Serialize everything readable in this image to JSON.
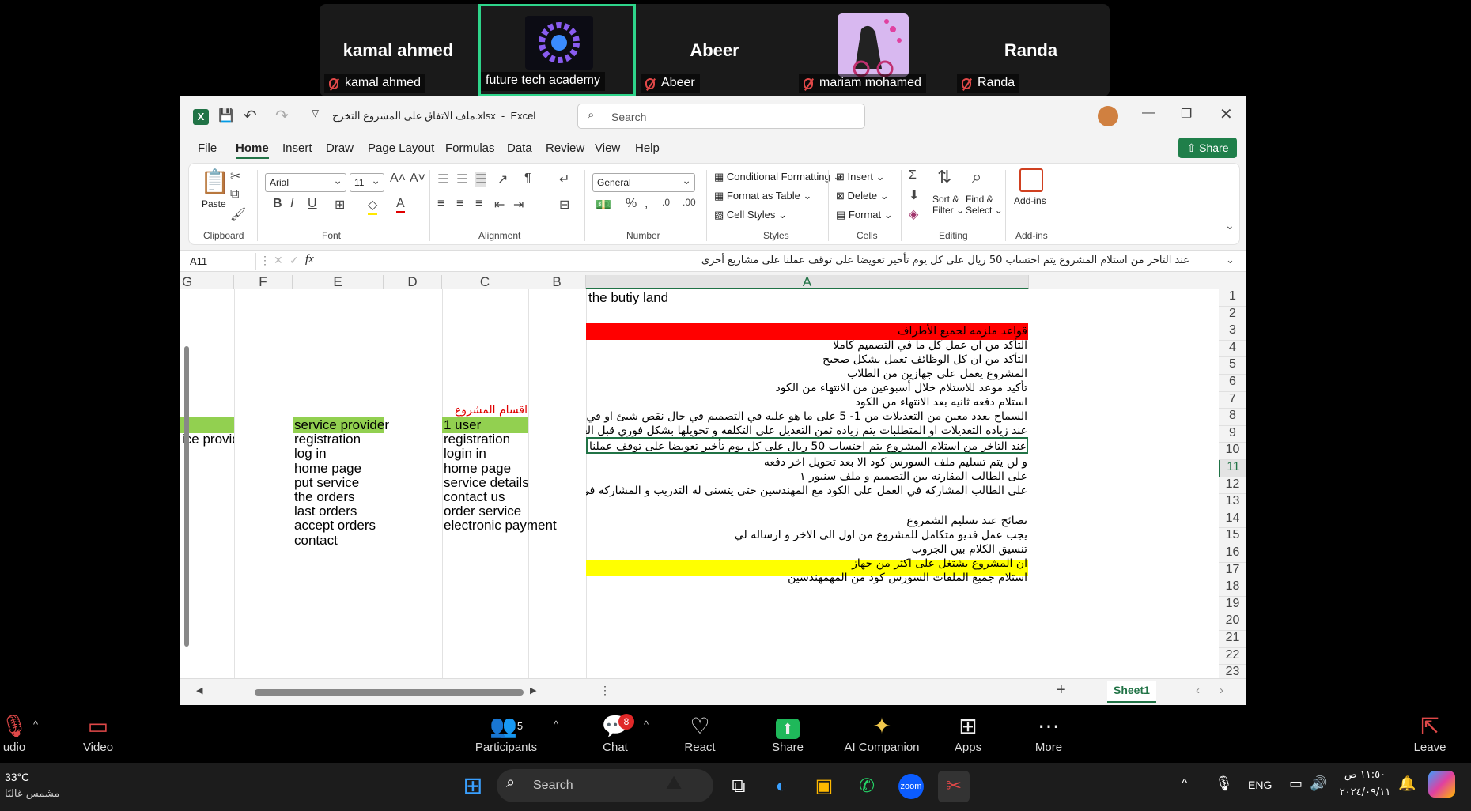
{
  "participants": [
    {
      "big": "kamal ahmed",
      "label": "kamal ahmed"
    },
    {
      "big": "",
      "label": "future tech academy"
    },
    {
      "big": "Abeer",
      "label": "Abeer"
    },
    {
      "big": "",
      "label": "mariam mohamed"
    },
    {
      "big": "Randa",
      "label": "Randa"
    }
  ],
  "window": {
    "filename": "ملف الاتفاق على المشروع التخرج.xlsx",
    "app": "Excel",
    "search": "Search"
  },
  "menu": [
    "File",
    "Home",
    "Insert",
    "Draw",
    "Page Layout",
    "Formulas",
    "Data",
    "Review",
    "View",
    "Help"
  ],
  "share_label": "Share",
  "ribbon": {
    "paste": "Paste",
    "clipboard": "Clipboard",
    "font": "Font",
    "alignment": "Alignment",
    "number": "Number",
    "styles": "Styles",
    "cells": "Cells",
    "editing": "Editing",
    "addins": "Add-ins",
    "font_name": "Arial",
    "font_size": "11",
    "number_format": "General",
    "cond": "Conditional Formatting",
    "fmt_table": "Format as Table",
    "cell_styles": "Cell Styles",
    "insert": "Insert",
    "delete": "Delete",
    "format": "Format",
    "sort": "Sort &",
    "filter": "Filter",
    "find": "Find &",
    "select": "Select",
    "addins_btn": "Add-ins"
  },
  "formula": {
    "namebox": "A11",
    "fx": "fx",
    "content": "عند التاخر من استلام المشروع يتم احتساب 50 ريال على كل يوم تأخير تعويضا على توقف عملنا على مشاريع أخرى"
  },
  "columns": [
    "G",
    "F",
    "E",
    "D",
    "C",
    "B",
    "A"
  ],
  "rows": [
    "1",
    "2",
    "3",
    "4",
    "5",
    "6",
    "7",
    "8",
    "9",
    "10",
    "11",
    "12",
    "13",
    "14",
    "15",
    "16",
    "17",
    "18",
    "19",
    "20",
    "21",
    "22",
    "23"
  ],
  "colA": {
    "1": "the butiy land",
    "3": "قواعد ملزمه لجميع الأطراف",
    "4": "التأكد من ان عمل كل ما في التصميم كاملا",
    "5": "التأكد من ان كل الوظائف تعمل بشكل صحيح",
    "6": "المشروع يعمل على جهازين من الطلاب",
    "7": "تأكيد موعد للاستلام خلال أسبوعين من الانتهاء من الكود",
    "8": "استلام دفعه ثانيه بعد الانتهاء من الكود",
    "9": "السماح بعدد معين من التعديلات من 1- 5 على ما هو عليه في التصميم في حال نقص شيئ او في خطا",
    "10": "عند زياده التعديلات او المتطلبات يتم زياده ثمن التعديل على التكلفه و تحويلها بشكل فوري  قبل العمل على التعديل",
    "11": "عند التاخر من استلام المشروع يتم احتساب 50 ريال على كل يوم تأخير تعويضا على توقف عملنا على مشاريع أخرى",
    "12": "و لن يتم تسليم ملف السورس كود الا بعد تحويل اخر دفعه",
    "13": "على الطالب المقارنه بين التصميم و ملف سنيور ١",
    "14": "على الطالب المشاركه في العمل على الكود مع المهندسين حتى يتسنى له التدريب و المشاركه في العمل على المشروع",
    "16": "نصائح عند تسليم الشمروع",
    "17": "يجب عمل فديو متكامل للمشروع من اول  الى الاخر و ارساله لي",
    "18": "تنسيق الكلام بين الجروب",
    "19": "ان المشروع يشتغل على اكثر من جهاز",
    "20": "استلام جميع الملفات السورس كود من المهمهندسين"
  },
  "colC": {
    "title": "اقسام المشروع",
    "items": [
      "1 user",
      "registration",
      "login in",
      "home page",
      "service details",
      "contact us",
      "order service",
      "electronic payment"
    ]
  },
  "colE": [
    "service provider",
    "registration",
    "log in",
    "home page",
    "put service",
    "the orders",
    "last orders",
    "accept orders",
    "contact"
  ],
  "colG": "ice provider",
  "sheet": "Sheet1",
  "zoom": {
    "audio": "udio",
    "video": "Video",
    "participants": "Participants",
    "participants_count": "5",
    "chat": "Chat",
    "chat_badge": "8",
    "react": "React",
    "share": "Share",
    "ai": "AI Companion",
    "apps": "Apps",
    "more": "More",
    "leave": "Leave"
  },
  "taskbar": {
    "temp": "33°C",
    "weather": "مشمس غالبًا",
    "search": "Search",
    "lang": "ENG",
    "time": "١١:٥٠ ص",
    "date": "٢٠٢٤/٠٩/١١"
  },
  "colors": {
    "red": "#ff0000",
    "yellow": "#ffff00",
    "green": "#92d050",
    "accent": "#217346"
  }
}
